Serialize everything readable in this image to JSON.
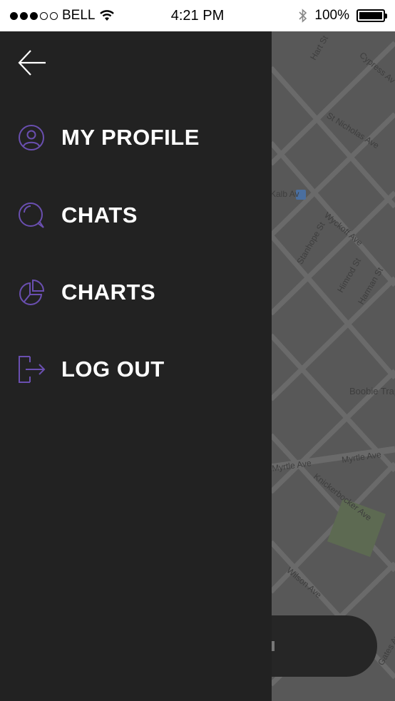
{
  "status_bar": {
    "carrier": "BELL",
    "time": "4:21 PM",
    "battery": "100%",
    "signal_dots_filled": 3,
    "signal_dots_total": 5
  },
  "drawer": {
    "back_icon": "arrow-left-icon",
    "items": [
      {
        "label": "MY PROFILE",
        "icon": "user-icon"
      },
      {
        "label": "CHATS",
        "icon": "chat-bubble-icon"
      },
      {
        "label": "CHARTS",
        "icon": "pie-chart-icon"
      },
      {
        "label": "LOG OUT",
        "icon": "logout-icon"
      }
    ]
  },
  "map": {
    "streets": [
      "Hart St",
      "Cypress Av",
      "St Nicholas Ave",
      "Kalb Av",
      "Wyckoff Ave",
      "Stanhope St",
      "Himrod St",
      "Harman St",
      "Boobie Trap",
      "Myrtle Ave",
      "Myrtle Ave",
      "Knickerbocker Ave",
      "Wilson Ave",
      "Gates Av"
    ]
  },
  "colors": {
    "drawer_bg": "#222222",
    "accent": "#6a4fb0",
    "menu_text": "#ffffff",
    "map_overlay": "#585858"
  }
}
